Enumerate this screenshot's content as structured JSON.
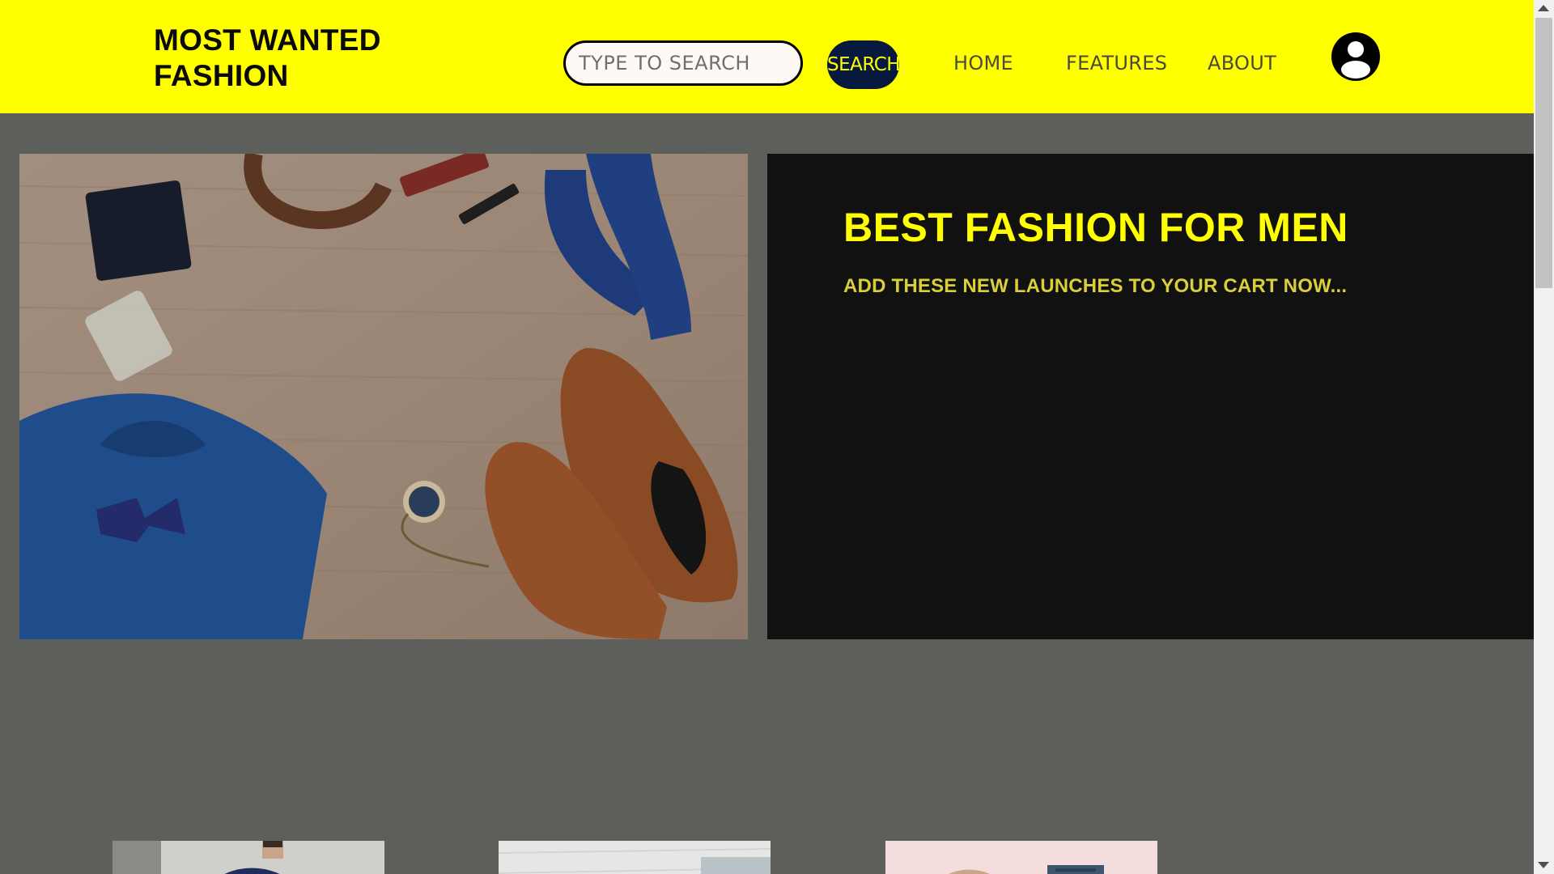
{
  "brand": {
    "line1": "MOST WANTED",
    "line2": "FASHION"
  },
  "search": {
    "placeholder": "TYPE TO SEARCH",
    "button_label": "SEARCH"
  },
  "nav": {
    "home": "HOME",
    "features": "FEATURES",
    "about": "ABOUT"
  },
  "user": {
    "icon": "user-circle-icon"
  },
  "hero": {
    "title": "BEST FASHION FOR MEN",
    "subtitle": "ADD THESE NEW LAUNCHES TO YOUR CART NOW..."
  },
  "colors": {
    "header_bg": "#ffff00",
    "page_bg": "#5d5f5b",
    "hero_panel_bg": "#111111",
    "accent_text": "#ffff00",
    "search_button_bg": "#071a3d"
  }
}
